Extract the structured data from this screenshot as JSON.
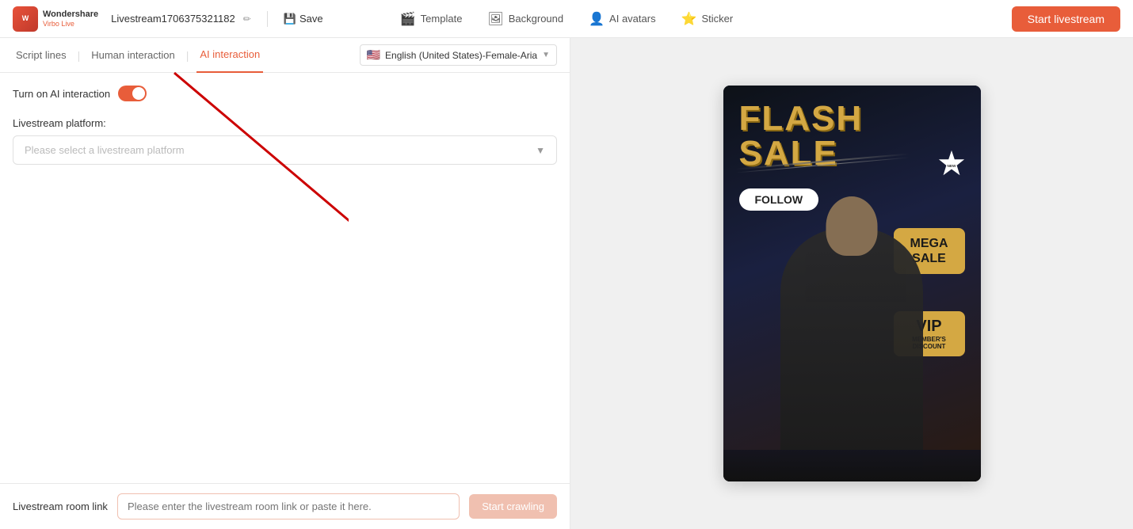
{
  "header": {
    "logo": {
      "line1": "Wondershare",
      "line2": "Virbo Live"
    },
    "stream_title": "Livestream1706375321182",
    "save_label": "Save",
    "nav_items": [
      {
        "id": "template",
        "label": "Template",
        "icon": "🎬"
      },
      {
        "id": "background",
        "label": "Background",
        "icon": "🖼"
      },
      {
        "id": "ai-avatars",
        "label": "AI avatars",
        "icon": "👤"
      },
      {
        "id": "sticker",
        "label": "Sticker",
        "icon": "⭐"
      }
    ],
    "start_btn": "Start livestream"
  },
  "tabs": [
    {
      "id": "script-lines",
      "label": "Script lines",
      "active": false
    },
    {
      "id": "human-interaction",
      "label": "Human interaction",
      "active": false
    },
    {
      "id": "ai-interaction",
      "label": "AI interaction",
      "active": true
    }
  ],
  "lang_selector": {
    "flag": "🇺🇸",
    "label": "English (United States)-Female-Aria"
  },
  "content": {
    "toggle_label": "Turn on AI interaction",
    "toggle_on": true,
    "platform_label": "Livestream platform:",
    "platform_placeholder": "Please select a livestream platform"
  },
  "bottom_bar": {
    "room_link_label": "Livestream room link",
    "room_link_placeholder": "Please enter the livestream room link or paste it here.",
    "crawl_btn": "Start crawling"
  }
}
